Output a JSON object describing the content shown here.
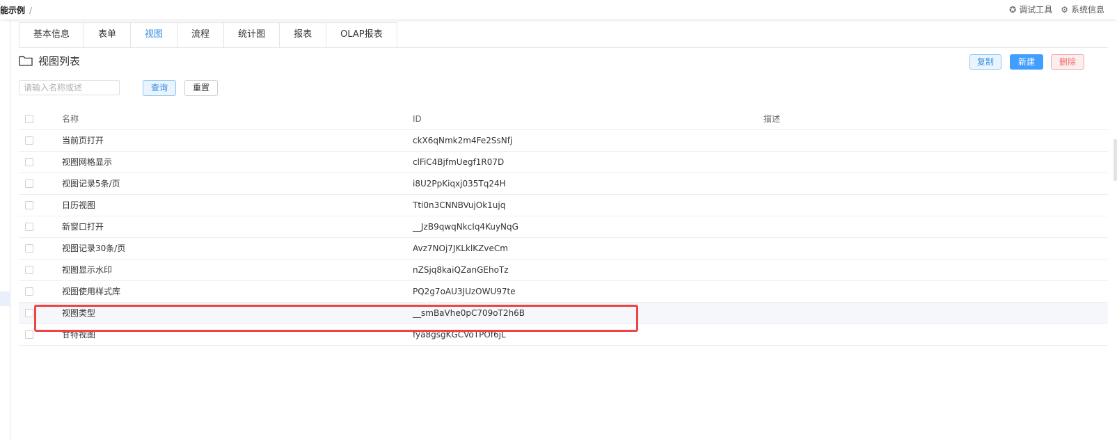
{
  "header": {
    "breadcrumb": "能示例",
    "breadcrumb_sep": "/",
    "debug_tool": "调试工具",
    "system_info": "系统信息"
  },
  "tabs": [
    {
      "label": "基本信息",
      "active": false
    },
    {
      "label": "表单",
      "active": false
    },
    {
      "label": "视图",
      "active": true
    },
    {
      "label": "流程",
      "active": false
    },
    {
      "label": "统计图",
      "active": false
    },
    {
      "label": "报表",
      "active": false
    },
    {
      "label": "OLAP报表",
      "active": false
    }
  ],
  "section": {
    "icon": "folder-icon",
    "title": "视图列表"
  },
  "toolbar": {
    "copy": "复制",
    "new": "新建",
    "delete": "删除"
  },
  "search": {
    "placeholder": "请输入名称或述",
    "value": "",
    "query": "查询",
    "reset": "重置"
  },
  "table": {
    "columns": {
      "name": "名称",
      "id": "ID",
      "desc": "描述"
    },
    "rows": [
      {
        "name": "当前页打开",
        "id": "ckX6qNmk2m4Fe2SsNfj",
        "desc": ""
      },
      {
        "name": "视图网格显示",
        "id": "clFiC4BjfmUegf1R07D",
        "desc": ""
      },
      {
        "name": "视图记录5条/页",
        "id": "i8U2PpKiqxj035Tq24H",
        "desc": ""
      },
      {
        "name": "日历视图",
        "id": "Tti0n3CNNBVujOk1ujq",
        "desc": ""
      },
      {
        "name": "新窗口打开",
        "id": "__JzB9qwqNkcIq4KuyNqG",
        "desc": ""
      },
      {
        "name": "视图记录30条/页",
        "id": "Avz7NOj7JKLklKZveCm",
        "desc": ""
      },
      {
        "name": "视图显示水印",
        "id": "nZSjq8kaiQZanGEhoTz",
        "desc": ""
      },
      {
        "name": "视图使用样式库",
        "id": "PQ2g7oAU3JUzOWU97te",
        "desc": ""
      },
      {
        "name": "视图类型",
        "id": "__smBaVhe0pC709oT2h6B",
        "desc": ""
      },
      {
        "name": "甘特视图",
        "id": "fya8gsgKGCVoTPOf6jL",
        "desc": ""
      }
    ]
  },
  "colors": {
    "accent": "#409eff",
    "danger": "#f56c6c",
    "highlight": "#ef4444"
  }
}
